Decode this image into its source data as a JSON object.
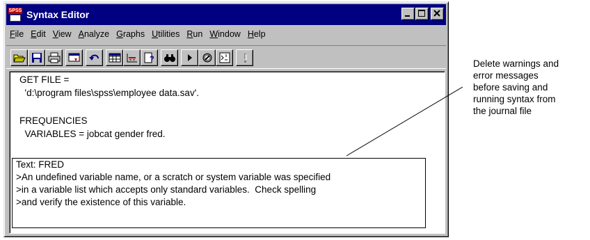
{
  "window": {
    "title": "Syntax Editor",
    "app_icon_text": "SPSS",
    "buttons": [
      "minimize-icon",
      "maximize-icon",
      "close-icon"
    ]
  },
  "menu": [
    {
      "label": "File",
      "key": "F"
    },
    {
      "label": "Edit",
      "key": "E"
    },
    {
      "label": "View",
      "key": "V"
    },
    {
      "label": "Analyze",
      "key": "A"
    },
    {
      "label": "Graphs",
      "key": "G"
    },
    {
      "label": "Utilities",
      "key": "U"
    },
    {
      "label": "Run",
      "key": "R"
    },
    {
      "label": "Window",
      "key": "W"
    },
    {
      "label": "Help",
      "key": "H"
    }
  ],
  "toolbar": [
    "open-icon",
    "save-icon",
    "print-icon",
    "dialog-recall-icon",
    "undo-icon",
    "data-editor-icon",
    "goto-case-icon",
    "variables-icon",
    "find-icon",
    "run-icon",
    "designate-window-icon",
    "syntax-help-icon",
    "exclamation-icon"
  ],
  "syntax": {
    "line1": "GET FILE =",
    "line2": "  'd:\\program files\\spss\\employee data.sav'.",
    "line3": "FREQUENCIES",
    "line4": "  VARIABLES = jobcat gender fred."
  },
  "error": {
    "line1": "Text: FRED",
    "line2": ">An undefined variable name, or a scratch or system variable was specified",
    "line3": ">in a variable list which accepts only standard variables.  Check spelling",
    "line4": ">and verify the existence of this variable."
  },
  "callout": {
    "line1": "Delete warnings and",
    "line2": "error messages",
    "line3": "before saving and",
    "line4": "running syntax from",
    "line5": "the journal file"
  }
}
